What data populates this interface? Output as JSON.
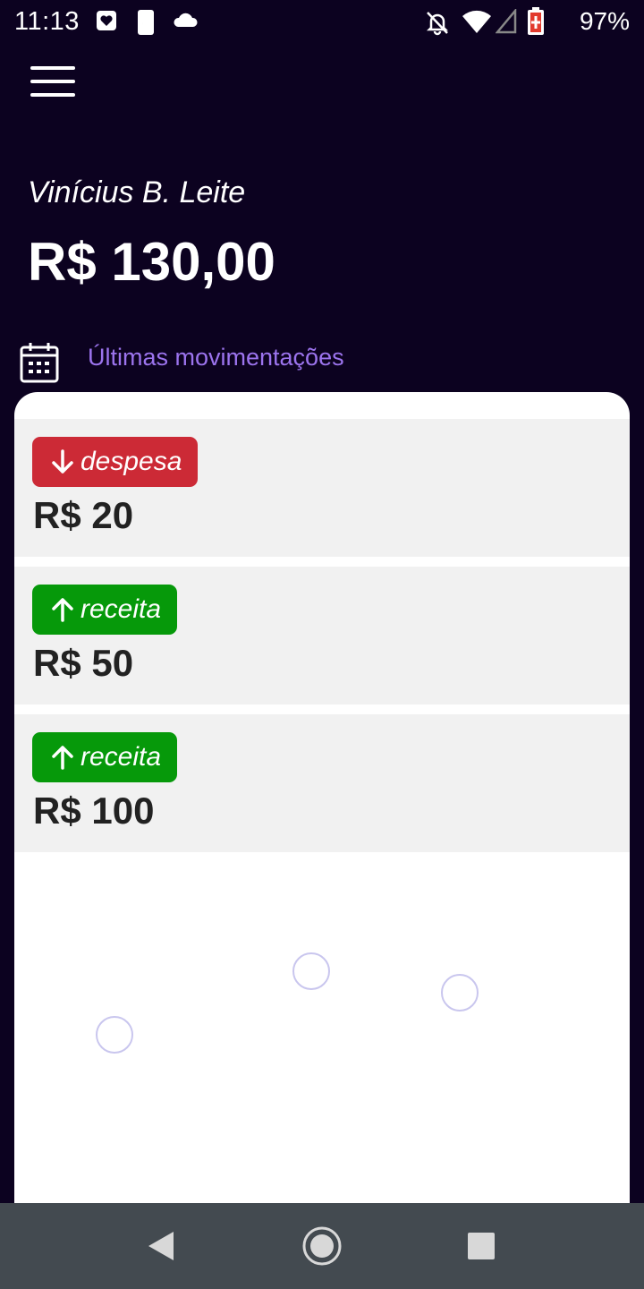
{
  "status_bar": {
    "time": "11:13",
    "battery_percent": "97%",
    "icons": [
      "heart-shield-icon",
      "phone-moon-icon",
      "cloud-icon",
      "bell-off-icon",
      "wifi-icon",
      "signal-icon",
      "battery-charging-icon"
    ]
  },
  "header": {
    "menu_icon": "hamburger-menu-icon",
    "user_name": "Vinícius B. Leite",
    "balance": "R$ 130,00"
  },
  "section": {
    "icon": "calendar-icon",
    "title": "Últimas movimentações"
  },
  "transactions": [
    {
      "type_label": "despesa",
      "direction": "down",
      "amount": "R$ 20",
      "color": "#cc2a36"
    },
    {
      "type_label": "receita",
      "direction": "up",
      "amount": "R$ 50",
      "color": "#06990a"
    },
    {
      "type_label": "receita",
      "direction": "up",
      "amount": "R$ 100",
      "color": "#06990a"
    }
  ],
  "colors": {
    "background": "#0c0220",
    "accent": "#9c74ee",
    "expense": "#cc2a36",
    "income": "#06990a",
    "card_item": "#f1f1f1",
    "nav_bar": "#434a50"
  },
  "nav_bar": {
    "icons": [
      "back-icon",
      "home-icon",
      "recents-icon"
    ]
  }
}
